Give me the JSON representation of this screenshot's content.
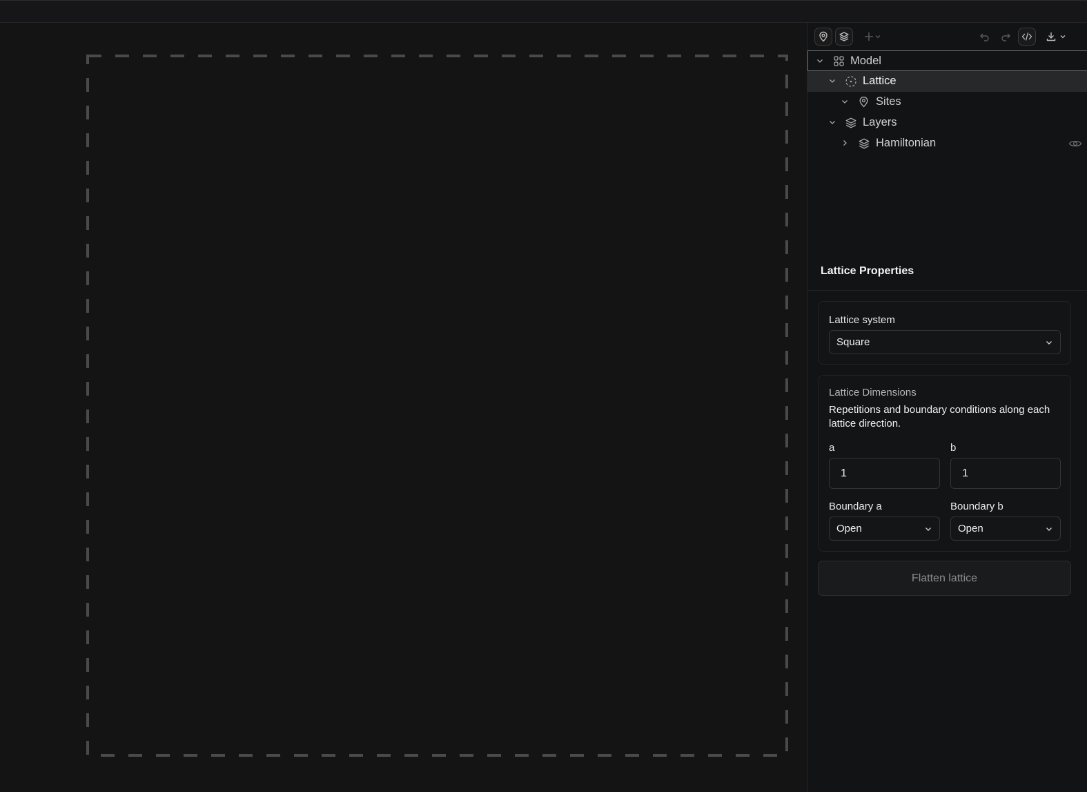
{
  "toolbar": {
    "left_icons": [
      "sites-pin-icon",
      "layers-icon",
      "add-icon",
      "chevron-down-icon"
    ],
    "right_icons": [
      "undo-icon",
      "redo-icon",
      "code-icon",
      "download-icon",
      "chevron-down-icon"
    ]
  },
  "tree": {
    "model": "Model",
    "lattice": "Lattice",
    "sites": "Sites",
    "layers": "Layers",
    "hamiltonian": "Hamiltonian"
  },
  "properties": {
    "title": "Lattice Properties",
    "lattice_system": {
      "label": "Lattice system",
      "value": "Square"
    },
    "dimensions": {
      "heading": "Lattice Dimensions",
      "description": "Repetitions and boundary conditions along each lattice direction.",
      "a_label": "a",
      "a_value": "1",
      "b_label": "b",
      "b_value": "1",
      "boundary_a_label": "Boundary a",
      "boundary_a_value": "Open",
      "boundary_b_label": "Boundary b",
      "boundary_b_value": "Open"
    },
    "flatten_label": "Flatten lattice"
  },
  "colors": {
    "background": "#141414",
    "panel": "#121314",
    "selected_row": "#27282a",
    "dashed_border": "#4a4a4a"
  }
}
